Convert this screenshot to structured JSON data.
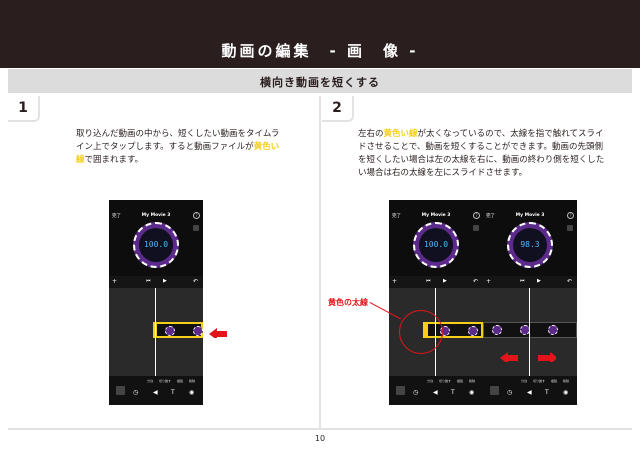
{
  "header": {
    "title": "動画の編集　- 画　像 -"
  },
  "subheader": {
    "title": "横向き動画を短くする"
  },
  "step1": {
    "number": "1",
    "text_before": "取り込んだ動画の中から、短くしたい動画をタイムライン上でタップします。すると動画ファイルが",
    "highlight": "黄色い線",
    "text_after": "で囲まれます。"
  },
  "step2": {
    "number": "2",
    "text_before": "左右の",
    "highlight": "黄色い線",
    "text_after": "が太くなっているので、太線を指で触れてスライドさせることで、動画を短くすることができます。動画の先頭側を短くしたい場合は左の太線を右に、動画の終わり側を短くしたい場合は右の太線を左にスライドさせます。",
    "callout": "黄色の太線"
  },
  "phones": [
    {
      "done": "完了",
      "title": "My Movie 3",
      "dial_value": "100.0",
      "dial_small": "1.0x"
    },
    {
      "done": "完了",
      "title": "My Movie 3",
      "dial_value": "100.0",
      "dial_small": "1.0x"
    },
    {
      "done": "完了",
      "title": "My Movie 3",
      "dial_value": "98.3",
      "dial_small": "1.0x"
    }
  ],
  "tools": {
    "labels": [
      "分割",
      "切り離す",
      "複製",
      "削除"
    ]
  },
  "icons": [
    "plus-icon",
    "skip-back-icon",
    "play-icon",
    "undo-icon",
    "help-icon",
    "zoom-icon",
    "speed-icon",
    "volume-icon",
    "text-icon",
    "filter-icon"
  ],
  "colors": {
    "header_bg": "#2a1f1e",
    "highlight": "#f5cf1a",
    "accent_red": "#e3151a",
    "dial_purple": "#5b2a8a",
    "dial_blue": "#4fb8ff"
  },
  "footer": {
    "page_number": "10"
  }
}
